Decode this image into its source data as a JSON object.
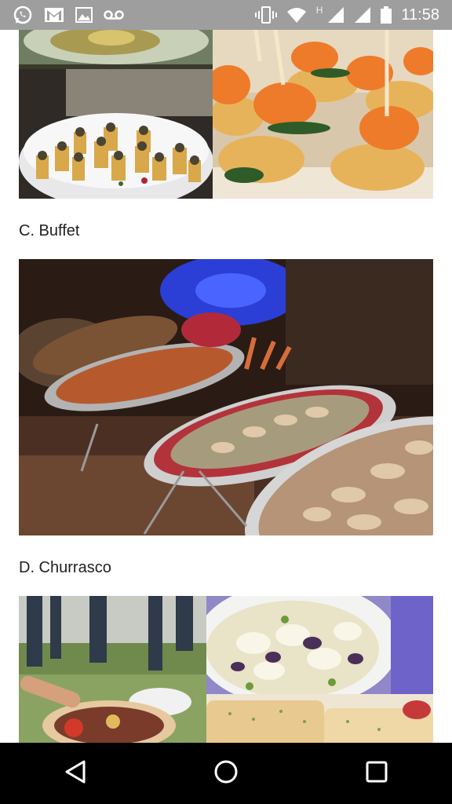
{
  "status_bar": {
    "time": "11:58",
    "network_letter": "H",
    "icons": [
      "whatsapp-icon",
      "gmail-icon",
      "gallery-icon",
      "voicemail-icon",
      "vibrate-icon",
      "wifi-icon",
      "signal-icon",
      "signal-icon",
      "battery-icon"
    ]
  },
  "sections": [
    {
      "label": "C. Buffet"
    },
    {
      "label": "D. Churrasco"
    }
  ],
  "images": [
    {
      "name": "plated-appetizer-photo"
    },
    {
      "name": "appetizer-cups-photo"
    },
    {
      "name": "shrimp-skewers-photo"
    },
    {
      "name": "buffet-trays-photo"
    },
    {
      "name": "churrasco-party-photo"
    },
    {
      "name": "salad-bowl-photo"
    },
    {
      "name": "garlic-bread-photo"
    }
  ],
  "nav_bar": {
    "buttons": [
      "back-icon",
      "home-icon",
      "recents-icon"
    ]
  },
  "colors": {
    "status_bar_bg": "#9e9e9e",
    "nav_bar_bg": "#000000",
    "page_bg": "#ffffff",
    "label_text": "#212121"
  }
}
